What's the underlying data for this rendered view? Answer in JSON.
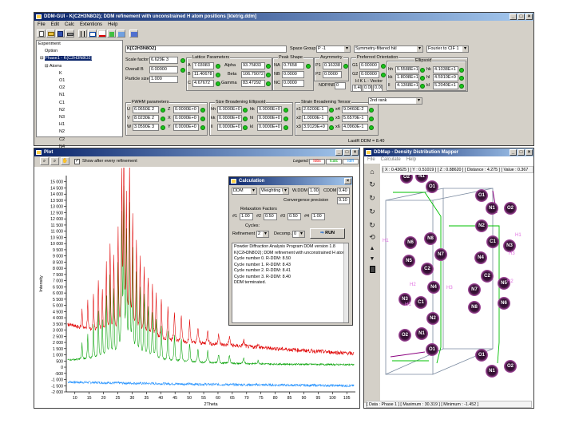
{
  "main": {
    "title": "DDM-GUI - K(C2H3N8O2); DDM refinement with unconstrained H atom positions [ktetrig.ddm]",
    "menus": [
      "File",
      "Edit",
      "Calc",
      "Extentions",
      "Help"
    ],
    "phase_name": "K[C2H3N8O2]",
    "tree": [
      "Experiment",
      "Option",
      "Phase1 - K(C2H3N8O2)",
      "Atoms",
      "K",
      "O1",
      "O2",
      "N1",
      "C1",
      "N2",
      "N3",
      "H1",
      "N2",
      "C2",
      "N4"
    ],
    "space_group_label": "Space Group",
    "space_group": "P -1",
    "symmetry_mode": "Symmetry-filtered hkl",
    "fourier_mode": "Fourier to CIF 1",
    "scale_label": "Scale factor",
    "scale": "6.629E 3",
    "overall_b_label": "Overall B",
    "overall_b": "0.00000",
    "particle_label": "Particle size",
    "particle": "1.000",
    "lattice_title": "Lattice Parameters",
    "a_label": "A",
    "a": "7.03083",
    "b_label": "B",
    "b": "11.40678",
    "c_label": "C",
    "c": "4.67672",
    "alpha_label": "Alpha",
    "alpha": "93.75833",
    "beta_label": "Beta",
    "beta": "106.79072",
    "gamma_label": "Gamma",
    "gamma": "83.47292",
    "peak_title": "Peak Shape",
    "na_label": "NA",
    "na": "0.7658",
    "nb_label": "NB",
    "nb": "0.0000",
    "nc_label": "NC",
    "nc": "0.0000",
    "asym_title": "Asymmetry",
    "p1_label": "P1",
    "p1": "0.16338",
    "p2_label": "P2",
    "p2": "0.0000",
    "ndp_label": "NDP/NR",
    "ndp": "0",
    "pref_title": "Preferred Orientation",
    "g1_label": "G1",
    "g1": "0.00000",
    "g2_label": "G2",
    "g2": "0.00000",
    "hkl_vec_label": "H K L - Vector",
    "hv": "0.40",
    "kv": "0.00",
    "lv": "0.00",
    "ellip_title": "Ellipsoid",
    "hh_label": "hh",
    "hh": "5.5588E+1",
    "kk_label": "kk",
    "kk": "1.8008E+1",
    "ll_label": "ll",
    "ll": "4.1368E+1",
    "hk_label": "hk",
    "hk": "4.1038E+1",
    "hl_label": "hl",
    "hl": "4.5910E+0",
    "kl_label": "kl",
    "kl": "5.2040E+1",
    "fwhm_title": "FWHM parameters",
    "u_label": "U",
    "u": "6.0650E 2",
    "v_label": "V",
    "v": "8.0230E 2",
    "w_label": "W",
    "w": "3.0590E 3",
    "z_label": "Z",
    "z": "0.0000E+0",
    "x_label": "X",
    "x": "0.0000E+0",
    "y_label": "Y",
    "y": "0.0000E+0",
    "size_title": "Size Broadening Ellipsoid",
    "shh_label": "hh",
    "shh": "0.0000E+0",
    "skk_label": "kk",
    "skk": "0.0000E+0",
    "sll_label": "ll",
    "sll": "0.0000E+0",
    "shk_label": "hk",
    "shk": "0.0000E+0",
    "shl_label": "hl",
    "shl": "0.0000E+0",
    "skl_label": "kl",
    "skl": "0.0000E+0",
    "strain_title": "Strain Broadening Tensor",
    "strain_rank": "2nd rank",
    "s1_label": "x1",
    "s1": "2.6200E-1",
    "s2_label": "x2",
    "s2": "1.0000E-1",
    "s3_label": "x3",
    "s3": "3.9120E+0",
    "s4_label": "x4",
    "s4": "9.0460E-2",
    "s5_label": "x5",
    "s5": "5.6570E-1",
    "s6_label": "x6",
    "s6": "4.0960E-1",
    "status": "LastR DDM = 8.40"
  },
  "plot": {
    "title": "Plot",
    "show_label": "Show after every refinement",
    "legend_label": "Legend:",
    "legend": [
      "Iobs",
      "Icalc",
      "Idiff"
    ],
    "xaxis_label": "2Theta",
    "yaxis_label": "Intensity"
  },
  "chart_data": {
    "type": "line",
    "xlabel": "2Theta",
    "ylabel": "Intensity",
    "xlim": [
      7,
      108
    ],
    "ylim": [
      -2000,
      15500
    ],
    "xticks": [
      10,
      15,
      20,
      25,
      30,
      35,
      40,
      45,
      50,
      55,
      60,
      65,
      70,
      75,
      80,
      85,
      90,
      95,
      100,
      105
    ],
    "yticks": [
      -2000,
      -1500,
      -1000,
      -500,
      0,
      500,
      1000,
      1500,
      2000,
      2500,
      3000,
      3500,
      4000,
      4500,
      5000,
      5500,
      6000,
      6500,
      7000,
      7500,
      8000,
      8500,
      9000,
      9500,
      10000,
      10500,
      11000,
      11500,
      12000,
      12500,
      13000,
      13500,
      14000,
      14500,
      15000
    ],
    "ytick_labels": [
      "-2 000",
      "-1 500",
      "-1 000",
      "-500",
      "0",
      "500",
      "1 000",
      "1 500",
      "2 000",
      "2 500",
      "3 000",
      "3 500",
      "4 000",
      "4 500",
      "5 000",
      "5 500",
      "6 000",
      "6 500",
      "7 000",
      "7 500",
      "8 000",
      "8 500",
      "9 000",
      "9 500",
      "10 000",
      "10 500",
      "11 000",
      "11 500",
      "12 000",
      "12 500",
      "13 000",
      "13 500",
      "14 000",
      "14 500",
      "15 000"
    ],
    "series": [
      {
        "name": "Iobs",
        "color": "#e00000",
        "baseline": [
          [
            7,
            3500
          ],
          [
            20,
            2600
          ],
          [
            30,
            2200
          ],
          [
            45,
            2000
          ],
          [
            60,
            1800
          ],
          [
            80,
            1500
          ],
          [
            107,
            1100
          ]
        ],
        "peaks": [
          [
            12.5,
            1500
          ],
          [
            14.5,
            2300
          ],
          [
            16.5,
            3100
          ],
          [
            18.2,
            4300
          ],
          [
            19.6,
            3500
          ],
          [
            21.0,
            5600
          ],
          [
            22.3,
            7300
          ],
          [
            23.6,
            6100
          ],
          [
            25.1,
            8300
          ],
          [
            26.4,
            12400
          ],
          [
            27.1,
            14600
          ],
          [
            28.0,
            10800
          ],
          [
            29.1,
            13700
          ],
          [
            30.2,
            9600
          ],
          [
            31.5,
            7600
          ],
          [
            32.8,
            6400
          ],
          [
            34.2,
            5800
          ],
          [
            35.6,
            4800
          ],
          [
            37.1,
            4300
          ],
          [
            38.4,
            3600
          ],
          [
            40.2,
            3200
          ],
          [
            42.5,
            2700
          ],
          [
            44.8,
            2400
          ],
          [
            47.2,
            2100
          ],
          [
            50.1,
            1800
          ],
          [
            53.0,
            1300
          ],
          [
            56.4,
            1200
          ],
          [
            60.2,
            900
          ],
          [
            64.0,
            700
          ],
          [
            69.0,
            500
          ],
          [
            74.0,
            300
          ]
        ]
      },
      {
        "name": "Icalc",
        "color": "#00a000",
        "baseline": [
          [
            7,
            600
          ],
          [
            20,
            600
          ],
          [
            30,
            500
          ],
          [
            45,
            400
          ],
          [
            60,
            300
          ],
          [
            80,
            250
          ],
          [
            107,
            200
          ]
        ],
        "peaks": [
          [
            12.5,
            1300
          ],
          [
            14.5,
            2000
          ],
          [
            16.5,
            2800
          ],
          [
            18.2,
            3900
          ],
          [
            19.6,
            3100
          ],
          [
            21.0,
            5000
          ],
          [
            22.3,
            6600
          ],
          [
            23.6,
            5400
          ],
          [
            25.1,
            7500
          ],
          [
            26.4,
            11000
          ],
          [
            27.1,
            13000
          ],
          [
            28.0,
            9600
          ],
          [
            29.1,
            12200
          ],
          [
            30.2,
            8600
          ],
          [
            31.5,
            6800
          ],
          [
            32.8,
            5700
          ],
          [
            34.2,
            5100
          ],
          [
            35.6,
            4200
          ],
          [
            37.1,
            3800
          ],
          [
            38.4,
            3200
          ],
          [
            40.2,
            2800
          ],
          [
            42.5,
            2400
          ],
          [
            44.8,
            2100
          ],
          [
            47.2,
            1800
          ],
          [
            50.1,
            1500
          ],
          [
            53.0,
            1100
          ],
          [
            56.4,
            1000
          ],
          [
            60.2,
            700
          ],
          [
            64.0,
            600
          ],
          [
            69.0,
            400
          ],
          [
            74.0,
            250
          ]
        ]
      },
      {
        "name": "Idiff",
        "color": "#2090ff",
        "baseline": [
          [
            7,
            -1200
          ],
          [
            30,
            -1300
          ],
          [
            60,
            -1400
          ],
          [
            107,
            -1500
          ]
        ],
        "peaks": []
      }
    ],
    "grid": false,
    "legend_placement": "top-right"
  },
  "calc": {
    "title": "Calculation",
    "method": "DDM",
    "weighting": "Weighting 0",
    "wddm_label": "W.DDM",
    "wddm": "1.00",
    "cddm_label": "CDDM",
    "cddm": "0.40",
    "conv_label": "Convergence precision",
    "conv": "0.10",
    "relax_label": "Relaxation Factors",
    "r1_label": "#1",
    "r1": "1.00",
    "r2_label": "#2",
    "r2": "0.50",
    "r3_label": "#3",
    "r3": "0.50",
    "r4_label": "#4",
    "r4": "1.00",
    "cycles_label": "Cycles:",
    "refine_label": "Refinement",
    "refine": "2",
    "decomp_label": "Decomp.",
    "decomp": "0",
    "run_label": "RUN",
    "log": [
      "Powder Diffraction Analysis Program DDM version 1.8",
      "K(C2H3N8O2); DDM refinement with unconstrained H ator",
      "Cycle number  0.  R-DDM:   8.50",
      "Cycle number  1.  R-DDM:   8.43",
      "Cycle number  2.  R-DDM:   8.41",
      "Cycle number  3.  R-DDM:   8.40",
      " DDM terminated."
    ]
  },
  "ddmap": {
    "title": "DDMap - Density Distribution Mapper",
    "menus": [
      "File",
      "Calculate",
      "Help"
    ],
    "coords": "[ X : 0.43625 ] [ Y : 0.51019 ] [ Z : 0.88620 ] [ Distance : 4.275 ] [ Value : 0.367",
    "status": "[ Data : Phase 1 ]  [ Maximum : 30.319 ]  [ Minimum : -1.452 ]",
    "tools": [
      "house-icon",
      "rotate-x-icon",
      "rotate-y-icon",
      "rotate-z-icon",
      "rotate-3d-icon",
      "reset-icon",
      "arrow-up-icon",
      "arrow-down-icon",
      "panel-icon"
    ],
    "atoms": [
      "O2",
      "N1",
      "O1",
      "O1",
      "N1",
      "O2",
      "N2",
      "N8",
      "C1",
      "N3",
      "N6",
      "N7",
      "N4",
      "N5",
      "C2",
      "C2",
      "N5",
      "N7",
      "N4",
      "N6",
      "N3",
      "C1",
      "N8",
      "N2",
      "O2",
      "N1",
      "O1",
      "O1",
      "N1",
      "O2"
    ],
    "hlabels": [
      "H1",
      "H2",
      "H3",
      "H2",
      "H3",
      "H1",
      "H1"
    ]
  }
}
